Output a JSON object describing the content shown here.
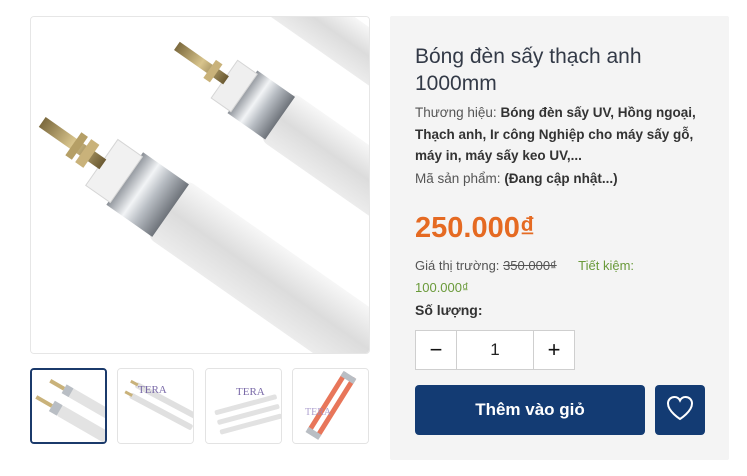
{
  "product": {
    "title": "Bóng đèn sấy thạch anh 1000mm",
    "brand_label": "Thương hiệu:",
    "brand_value": "Bóng đèn sấy UV, Hồng ngoại, Thạch anh, Ir công Nghiệp cho máy sấy gỗ, máy in, máy sấy keo UV,...",
    "sku_label": "Mã sản phẩm:",
    "sku_value": "(Đang cập nhật...)",
    "price": "250.000₫",
    "market_label": "Giá thị trường:",
    "market_price": "350.000₫",
    "save_label": "Tiết kiệm:",
    "save_value": "100.000₫",
    "qty_label": "Số lượng:",
    "qty_value": "1",
    "minus": "−",
    "plus": "+",
    "add_to_cart": "Thêm vào giỏ"
  },
  "gallery": {
    "thumb_logo": "TERA"
  },
  "icons": {
    "wishlist": "heart-icon"
  },
  "colors": {
    "price": "#e56a22",
    "primary": "#133b73",
    "save": "#6a9a3a"
  }
}
